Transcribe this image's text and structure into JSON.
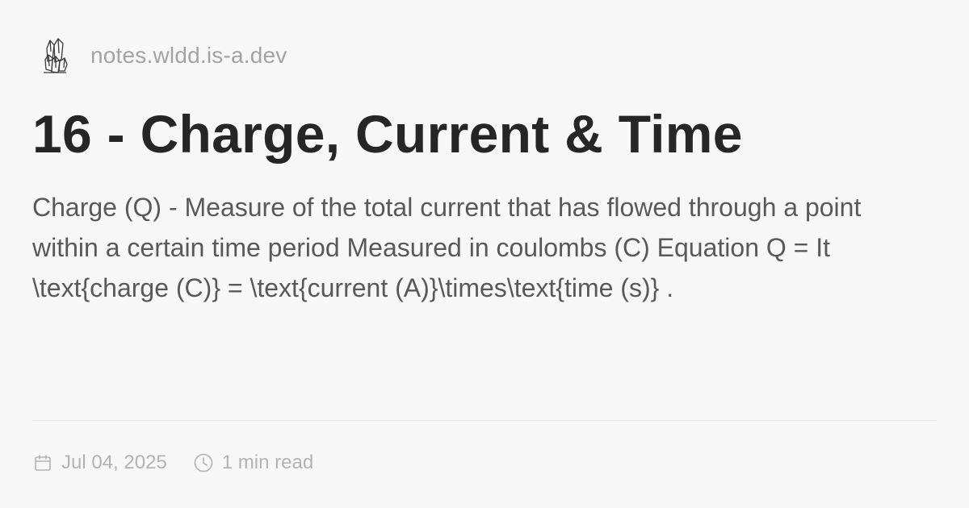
{
  "site": {
    "logo_icon": "crystal-logo-icon",
    "name": "notes.wldd.is-a.dev"
  },
  "article": {
    "title": "16 - Charge, Current & Time",
    "description": "Charge (Q) - Measure of the total current that has flowed through a point within a certain time period Measured in coulombs (C) Equation Q = It \\text{charge (C)} = \\text{current (A)}\\times\\text{time (s)} ."
  },
  "meta": {
    "date_icon": "calendar-icon",
    "date": "Jul 04, 2025",
    "read_icon": "clock-icon",
    "read_time": "1 min read"
  },
  "colors": {
    "background": "#f8f7f8",
    "title": "#262626",
    "description": "#595959",
    "muted": "#a3a3a3"
  }
}
